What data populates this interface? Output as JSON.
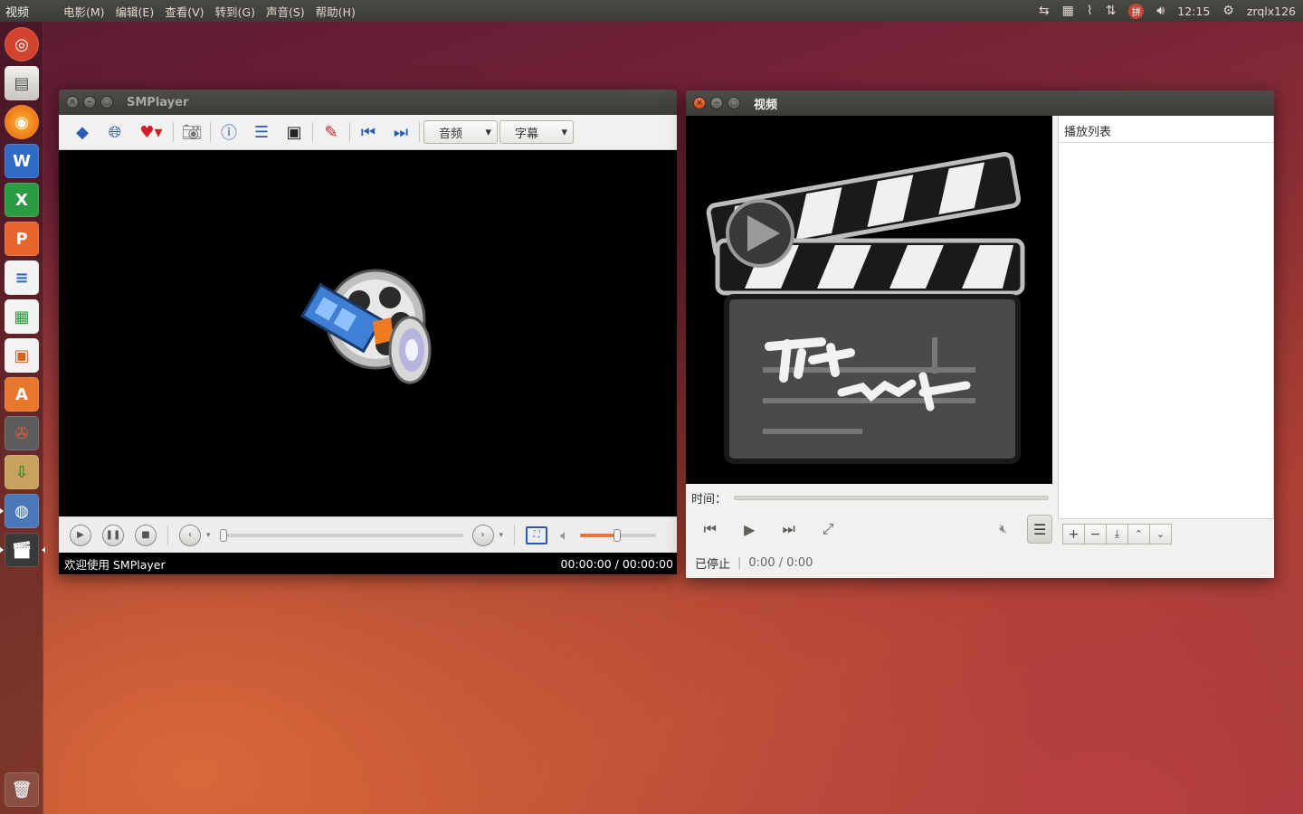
{
  "top_panel": {
    "app_name": "视频",
    "menus": [
      "电影(M)",
      "编辑(E)",
      "查看(V)",
      "转到(G)",
      "声音(S)",
      "帮助(H)"
    ],
    "clock": "12:15",
    "user": "zrqlx126",
    "input_method_badge": "拼"
  },
  "launcher": {
    "items": [
      "ubuntu-dash",
      "files",
      "firefox",
      "wps-writer",
      "wps-spreadsheets",
      "wps-presentation",
      "libreoffice-writer",
      "libreoffice-calc",
      "libreoffice-impress",
      "software-center",
      "system-settings",
      "archive-manager",
      "smplayer",
      "videos",
      "trash"
    ]
  },
  "smplayer": {
    "title": "SMPlayer",
    "audio_combo": "音频",
    "subtitle_combo": "字幕",
    "status_left": "欢迎使用 SMPlayer",
    "status_time": "00:00:00 / 00:00:00"
  },
  "totem": {
    "title": "视频",
    "time_label": "时间：",
    "status": "已停止",
    "time_display": "0:00 / 0:00",
    "playlist_title": "播放列表"
  }
}
